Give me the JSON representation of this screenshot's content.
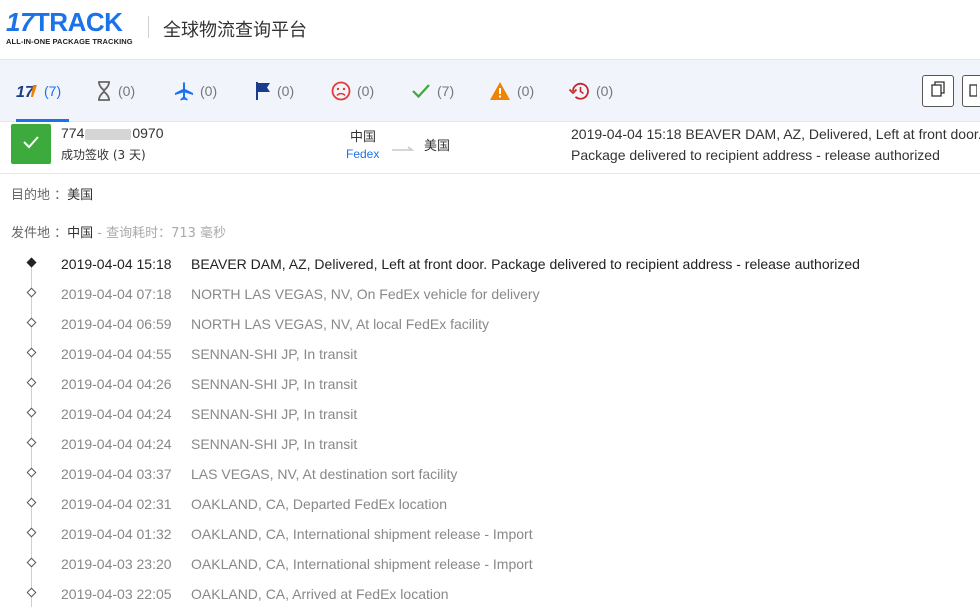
{
  "header": {
    "logo_number": "17",
    "logo_word": "TRACK",
    "logo_tagline": "ALL-IN-ONE PACKAGE TRACKING",
    "title": "全球物流查询平台"
  },
  "tabs": [
    {
      "name": "all",
      "icon": "17track-logo-icon",
      "count": "(7)",
      "active": true
    },
    {
      "name": "not-found",
      "icon": "hourglass-icon",
      "count": "(0)"
    },
    {
      "name": "in-transit",
      "icon": "airplane-icon",
      "count": "(0)"
    },
    {
      "name": "pickup",
      "icon": "flag-icon",
      "count": "(0)"
    },
    {
      "name": "undelivered",
      "icon": "sad-face-icon",
      "count": "(0)"
    },
    {
      "name": "delivered",
      "icon": "check-icon",
      "count": "(7)"
    },
    {
      "name": "alert",
      "icon": "warning-icon",
      "count": "(0)"
    },
    {
      "name": "expired",
      "icon": "history-icon",
      "count": "(0)"
    }
  ],
  "summary": {
    "tracking_prefix": "774",
    "tracking_suffix": "0970",
    "status": "成功签收 (3 天)",
    "origin": "中国",
    "carrier": "Fedex",
    "destination": "美国",
    "latest_line1": "2019-04-04 15:18  BEAVER DAM, AZ, Delivered, Left at front door.",
    "latest_line2": "Package delivered to recipient address - release authorized"
  },
  "info": {
    "dest_label": "目的地 ：",
    "dest_value": "美国",
    "origin_label": "发件地 ：",
    "origin_value": "中国",
    "elapsed": " - 查询耗时：713 毫秒"
  },
  "events": [
    {
      "time": "2019-04-04 15:18",
      "desc": "BEAVER DAM, AZ, Delivered, Left at front door. Package delivered to recipient address - release authorized"
    },
    {
      "time": "2019-04-04 07:18",
      "desc": "NORTH LAS VEGAS, NV, On FedEx vehicle for delivery"
    },
    {
      "time": "2019-04-04 06:59",
      "desc": "NORTH LAS VEGAS, NV, At local FedEx facility"
    },
    {
      "time": "2019-04-04 04:55",
      "desc": "SENNAN-SHI JP, In transit"
    },
    {
      "time": "2019-04-04 04:26",
      "desc": "SENNAN-SHI JP, In transit"
    },
    {
      "time": "2019-04-04 04:24",
      "desc": "SENNAN-SHI JP, In transit"
    },
    {
      "time": "2019-04-04 04:24",
      "desc": "SENNAN-SHI JP, In transit"
    },
    {
      "time": "2019-04-04 03:37",
      "desc": "LAS VEGAS, NV, At destination sort facility"
    },
    {
      "time": "2019-04-04 02:31",
      "desc": "OAKLAND, CA, Departed FedEx location"
    },
    {
      "time": "2019-04-04 01:32",
      "desc": "OAKLAND, CA, International shipment release - Import"
    },
    {
      "time": "2019-04-03 23:20",
      "desc": "OAKLAND, CA, International shipment release - Import"
    },
    {
      "time": "2019-04-03 22:05",
      "desc": "OAKLAND, CA, Arrived at FedEx location"
    }
  ],
  "colors": {
    "brand": "#1a73e8",
    "delivered": "#3caa3c",
    "alert": "#f08300",
    "undelivered": "#e53935",
    "expired": "#c62828"
  }
}
